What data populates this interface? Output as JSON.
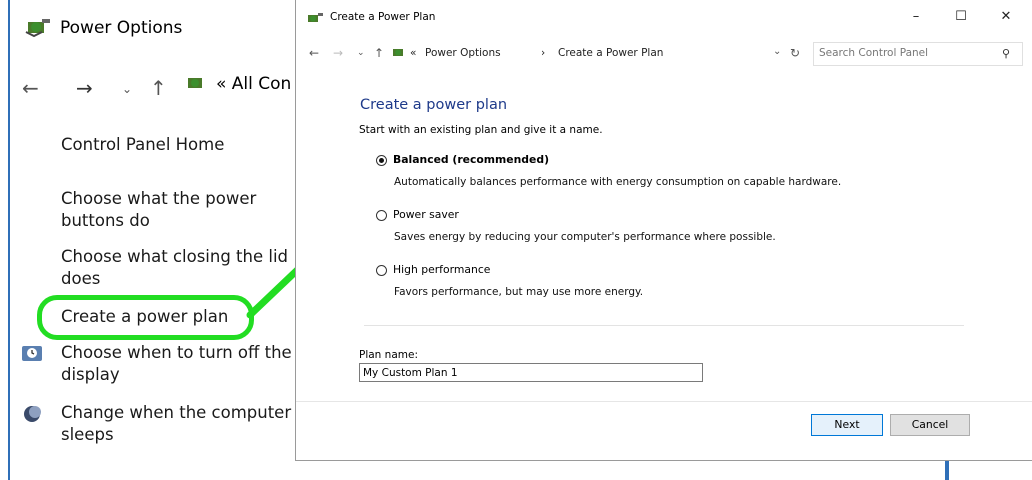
{
  "background_window": {
    "title": "Power Options",
    "address_text": "« All Con",
    "links": [
      {
        "label_line1": "Control Panel Home",
        "label_line2": ""
      },
      {
        "label_line1": "Choose what the power",
        "label_line2": "buttons do"
      },
      {
        "label_line1": "Choose what closing the lid",
        "label_line2": "does"
      },
      {
        "label_line1": "Create a power plan",
        "label_line2": ""
      },
      {
        "label_line1": "Choose when to turn off the",
        "label_line2": "display"
      },
      {
        "label_line1": "Change when the computer",
        "label_line2": "sleeps"
      }
    ]
  },
  "dialog": {
    "title": "Create a Power Plan",
    "window_buttons": {
      "minimize": "–",
      "maximize": "☐",
      "close": "✕"
    },
    "breadcrumb": {
      "prefix": "«",
      "part1": "Power Options",
      "sep": "›",
      "part2": "Create a Power Plan"
    },
    "search_placeholder": "Search Control Panel",
    "heading": "Create a power plan",
    "intro": "Start with an existing plan and give it a name.",
    "options": [
      {
        "label": "Balanced (recommended)",
        "description": "Automatically balances performance with energy consumption on capable hardware.",
        "selected": true
      },
      {
        "label": "Power saver",
        "description": "Saves energy by reducing your computer's performance where possible.",
        "selected": false
      },
      {
        "label": "High performance",
        "description": "Favors performance, but may use more energy.",
        "selected": false
      }
    ],
    "plan_name_label": "Plan name:",
    "plan_name_value": "My Custom Plan 1",
    "next_label": "Next",
    "cancel_label": "Cancel"
  },
  "colors": {
    "highlight": "#22dd22",
    "heading": "#1e3a8a",
    "accent": "#0078d7"
  }
}
